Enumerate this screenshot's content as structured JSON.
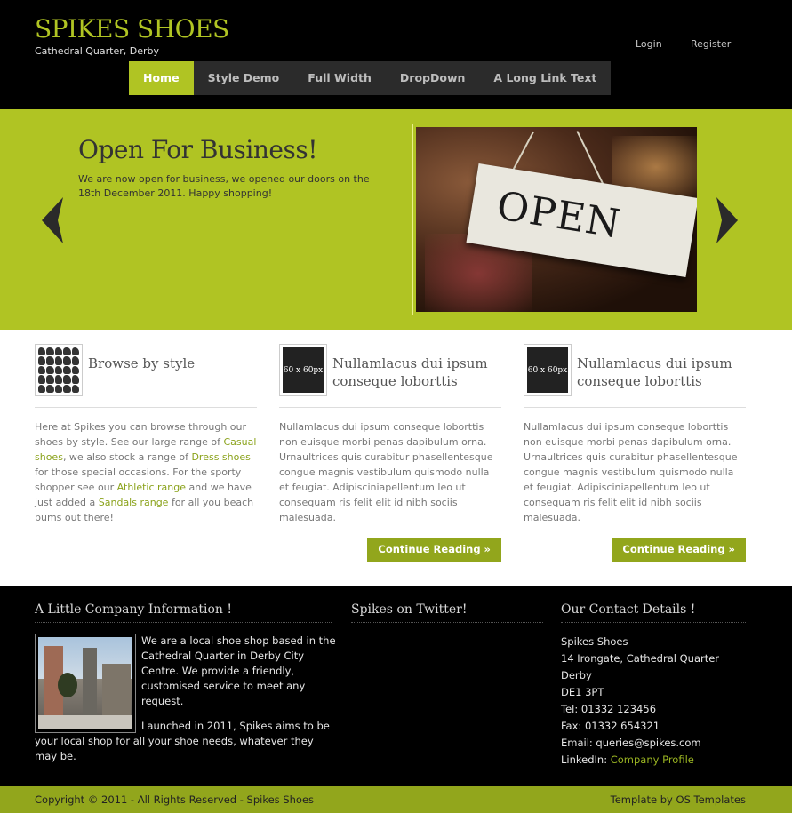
{
  "header": {
    "logo": "SPIKES SHOES",
    "tagline": "Cathedral Quarter, Derby",
    "login": "Login",
    "register": "Register"
  },
  "nav": [
    {
      "label": "Home",
      "active": true
    },
    {
      "label": "Style Demo"
    },
    {
      "label": "Full Width"
    },
    {
      "label": "DropDown"
    },
    {
      "label": "A Long Link Text"
    }
  ],
  "slider": {
    "title": "Open For Business!",
    "text": "We are now open for business, we opened our doors on the 18th December 2011. Happy shopping!",
    "image_sign": "OPEN",
    "prev_icon": "chevron-left-icon",
    "next_icon": "chevron-right-icon"
  },
  "columns": [
    {
      "title": "Browse by style",
      "text_parts": [
        "Here at Spikes you can browse through our shoes by style. See our large range of ",
        "Casual shoes",
        ", we also stock a range of ",
        "Dress shoes",
        " for those special occasions. For the sporty shopper see our ",
        "Athletic range",
        " and we have just added a ",
        "Sandals range",
        " for all you beach bums out there!"
      ]
    },
    {
      "thumb": "60 x 60px",
      "title": "Nullamlacus dui ipsum conseque loborttis",
      "text": "Nullamlacus dui ipsum conseque loborttis non euisque morbi penas dapibulum orna. Urnaultrices quis curabitur phasellentesque congue magnis vestibulum quismodo nulla et feugiat. Adipisciniapellentum leo ut consequam ris felit elit id nibh sociis malesuada.",
      "button": "Continue Reading »"
    },
    {
      "thumb": "60 x 60px",
      "title": "Nullamlacus dui ipsum conseque loborttis",
      "text": "Nullamlacus dui ipsum conseque loborttis non euisque morbi penas dapibulum orna. Urnaultrices quis curabitur phasellentesque congue magnis vestibulum quismodo nulla et feugiat. Adipisciniapellentum leo ut consequam ris felit elit id nibh sociis malesuada.",
      "button": "Continue Reading »"
    }
  ],
  "footer": {
    "about": {
      "title": "A Little Company Information !",
      "p1": "We are a local shoe shop based in the Cathedral Quarter in Derby City Centre. We provide a friendly, customised service to meet any request.",
      "p2": "Launched in 2011, Spikes aims to be your local shop for all your shoe needs, whatever they may be."
    },
    "twitter": {
      "title": "Spikes on Twitter!"
    },
    "contact": {
      "title": "Our Contact Details !",
      "name": "Spikes Shoes",
      "address1": "14 Irongate, Cathedral Quarter",
      "city": "Derby",
      "postcode": "DE1 3PT",
      "tel": "Tel: 01332 123456",
      "fax": "Fax: 01332 654321",
      "email": "Email: queries@spikes.com",
      "linkedin_label": "LinkedIn: ",
      "linkedin_link": "Company Profile"
    }
  },
  "bottom": {
    "copyright": "Copyright © 2011 - All Rights Reserved - Spikes Shoes",
    "credit": "Template by OS Templates"
  },
  "colors": {
    "accent": "#b0c423",
    "button": "#92a61c",
    "dark": "#000000"
  }
}
